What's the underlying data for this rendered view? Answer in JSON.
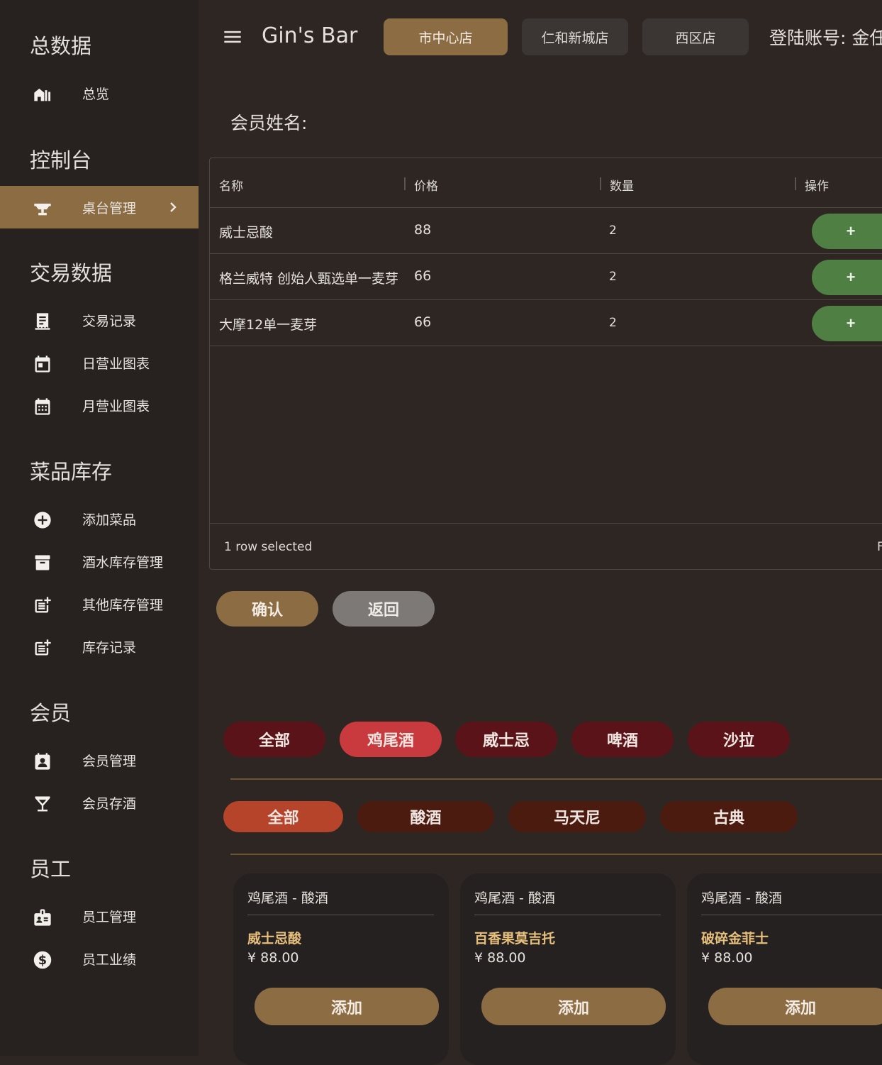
{
  "sidebar": {
    "sections": [
      {
        "title": "总数据",
        "items": [
          {
            "label": "总览",
            "icon": "dashboard-icon"
          }
        ]
      },
      {
        "title": "控制台",
        "items": [
          {
            "label": "桌台管理",
            "icon": "table-icon",
            "active": true
          }
        ]
      },
      {
        "title": "交易数据",
        "items": [
          {
            "label": "交易记录",
            "icon": "receipt-icon"
          },
          {
            "label": "日营业图表",
            "icon": "calendar-day-icon"
          },
          {
            "label": "月营业图表",
            "icon": "calendar-month-icon"
          }
        ]
      },
      {
        "title": "菜品库存",
        "items": [
          {
            "label": "添加菜品",
            "icon": "add-circle-icon"
          },
          {
            "label": "酒水库存管理",
            "icon": "archive-icon"
          },
          {
            "label": "其他库存管理",
            "icon": "post-add-icon"
          },
          {
            "label": "库存记录",
            "icon": "post-add-icon"
          }
        ]
      },
      {
        "title": "会员",
        "items": [
          {
            "label": "会员管理",
            "icon": "member-badge-icon"
          },
          {
            "label": "会员存酒",
            "icon": "cocktail-glass-icon"
          }
        ]
      },
      {
        "title": "员工",
        "items": [
          {
            "label": "员工管理",
            "icon": "staff-badge-icon"
          },
          {
            "label": "员工业绩",
            "icon": "dollar-icon"
          }
        ]
      }
    ]
  },
  "header": {
    "app_title": "Gin's Bar",
    "stores": [
      {
        "label": "市中心店",
        "active": true
      },
      {
        "label": "仁和新城店",
        "active": false
      },
      {
        "label": "西区店",
        "active": false
      }
    ],
    "login_label": "登陆账号: 金任"
  },
  "member": {
    "label": "会员姓名:"
  },
  "table": {
    "columns": [
      "名称",
      "价格",
      "数量",
      "操作"
    ],
    "rows": [
      {
        "name": "威士忌酸",
        "price": "88",
        "qty": "2",
        "action": "+"
      },
      {
        "name": "格兰威特 创始人甄选单一麦芽",
        "price": "66",
        "qty": "2",
        "action": "+"
      },
      {
        "name": "大摩12单一麦芽",
        "price": "66",
        "qty": "2",
        "action": "+"
      }
    ],
    "footer": "1 row selected",
    "footer_edge": "F"
  },
  "actions": {
    "confirm": "确认",
    "back": "返回"
  },
  "categories": [
    {
      "label": "全部",
      "active": false
    },
    {
      "label": "鸡尾酒",
      "active": true
    },
    {
      "label": "威士忌",
      "active": false
    },
    {
      "label": "啤酒",
      "active": false
    },
    {
      "label": "沙拉",
      "active": false
    }
  ],
  "subcategories": [
    {
      "label": "全部",
      "active": true
    },
    {
      "label": "酸酒",
      "active": false
    },
    {
      "label": "马天尼",
      "active": false
    },
    {
      "label": "古典",
      "active": false
    }
  ],
  "products": [
    {
      "category": "鸡尾酒 - 酸酒",
      "name": "威士忌酸",
      "price": "¥ 88.00",
      "add": "添加"
    },
    {
      "category": "鸡尾酒 - 酸酒",
      "name": "百香果莫吉托",
      "price": "¥ 88.00",
      "add": "添加"
    },
    {
      "category": "鸡尾酒 - 酸酒",
      "name": "破碎金菲士",
      "price": "¥ 88.00",
      "add": "添加"
    }
  ],
  "colors": {
    "accent_gold": "#8c6c43",
    "sidebar_bg": "#272220",
    "main_bg": "#2d2622",
    "add_green": "#4f7f42",
    "category_active": "#c93a3e",
    "subcategory_active": "#b5442a",
    "product_name": "#e7bf7c"
  }
}
